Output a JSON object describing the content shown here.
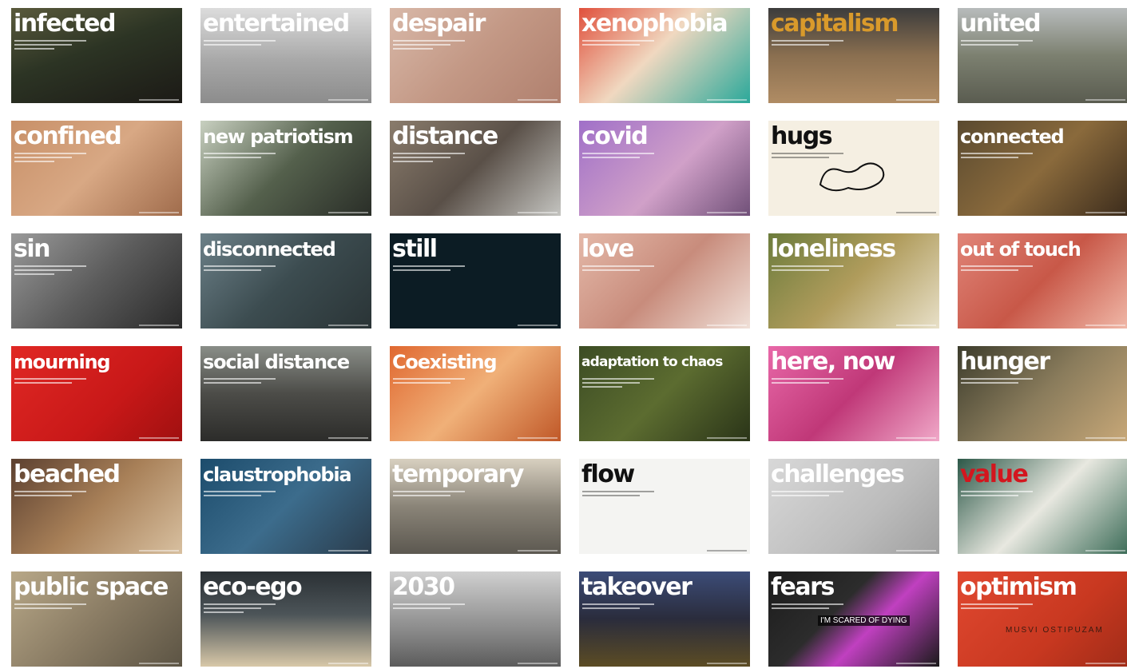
{
  "tiles": [
    {
      "word": "infected",
      "bg": "linear-gradient(160deg,#5a5a3c 0%,#2c3424 45%,#1c1a16 100%)"
    },
    {
      "word": "entertained",
      "bg": "linear-gradient(180deg,#dcdcdc 0%,#a8a8a8 55%,#8c8c8c 100%)"
    },
    {
      "word": "despair",
      "bg": "linear-gradient(135deg,#d8b8a8 0%,#c39885 50%,#b0806e 100%)"
    },
    {
      "word": "xenophobia",
      "bg": "linear-gradient(135deg,#e0503c 0%,#f0d8c0 45%,#2aa89a 100%)"
    },
    {
      "word": "capitalism",
      "bg": "linear-gradient(180deg,#3c3c3c 0%,#8a6f50 50%,#b08c64 100%)",
      "style": "gold"
    },
    {
      "word": "united",
      "bg": "linear-gradient(180deg,#b8bcbc 0%,#7c8070 50%,#5a5c50 100%)"
    },
    {
      "word": "confined",
      "bg": "linear-gradient(135deg,#c89068 0%,#d8a884 50%,#a06c4c 100%)"
    },
    {
      "word": "new patriotism",
      "bg": "linear-gradient(135deg,#c8d0c0 0%,#54604c 50%,#2a2e28 100%)",
      "style": "small"
    },
    {
      "word": "distance",
      "bg": "linear-gradient(135deg,#8a7c6c 0%,#5a5048 50%,#c4c4c0 100%)"
    },
    {
      "word": "covid",
      "bg": "linear-gradient(135deg,#a070c8 0%,#d0a0c8 55%,#705078 100%)"
    },
    {
      "word": "hugs",
      "bg": "#f5efe2",
      "style": "dark",
      "light": true
    },
    {
      "word": "connected",
      "bg": "linear-gradient(135deg,#5a4a30 0%,#8a6a3c 50%,#3c2c1c 100%)",
      "style": "small"
    },
    {
      "word": "sin",
      "bg": "linear-gradient(135deg,#9a9a9a 0%,#5c5c5c 50%,#2a2a2a 100%)"
    },
    {
      "word": "disconnected",
      "bg": "linear-gradient(135deg,#6c8088 0%,#3c4c50 50%,#2a3436 100%)",
      "style": "small"
    },
    {
      "word": "still",
      "bg": "#0c1c24"
    },
    {
      "word": "love",
      "bg": "linear-gradient(135deg,#e4b8a8 0%,#c88c7c 50%,#f0e0d8 100%)"
    },
    {
      "word": "loneliness",
      "bg": "linear-gradient(135deg,#6c7c3c 0%,#b09c5c 50%,#e8e0c8 100%)"
    },
    {
      "word": "out of touch",
      "bg": "linear-gradient(135deg,#e08478 0%,#c85848 50%,#f0b8a8 100%)",
      "style": "small"
    },
    {
      "word": "mourning",
      "bg": "linear-gradient(135deg,#e02824 0%,#c81818 60%,#a01010 100%)",
      "style": "small"
    },
    {
      "word": "social distance",
      "bg": "linear-gradient(180deg,#8a8e88 0%,#4c4c48 50%,#2c2c2a 100%)",
      "style": "small"
    },
    {
      "word": "Coexisting",
      "bg": "linear-gradient(135deg,#e06830 0%,#f0b078 50%,#c05828 100%)",
      "style": "small"
    },
    {
      "word": "adaptation to chaos",
      "bg": "linear-gradient(135deg,#3c4c24 0%,#5c6c30 50%,#2a3418 100%)",
      "style": "xsmall"
    },
    {
      "word": "here, now",
      "bg": "linear-gradient(135deg,#e868a8 0%,#c03878 50%,#f0a8c8 100%)"
    },
    {
      "word": "hunger",
      "bg": "linear-gradient(135deg,#3c3c2c 0%,#8a7c5c 50%,#c8a878 100%)"
    },
    {
      "word": "beached",
      "bg": "linear-gradient(135deg,#5c4030 0%,#a88058 50%,#d8c0a0 100%)"
    },
    {
      "word": "claustrophobia",
      "bg": "linear-gradient(135deg,#1c4c6c 0%,#3c6c8c 50%,#2a3c4c 100%)",
      "style": "small"
    },
    {
      "word": "temporary",
      "bg": "linear-gradient(180deg,#d8d0c0 0%,#8a8478 50%,#5c5850 100%)"
    },
    {
      "word": "flow",
      "bg": "#f4f4f2",
      "style": "dark",
      "light": true
    },
    {
      "word": "challenges",
      "bg": "linear-gradient(135deg,#d8d8d8 0%,#bcbcbc 60%,#a0a0a0 100%)"
    },
    {
      "word": "value",
      "bg": "linear-gradient(135deg,#2c5848 0%,#e8e8e0 50%,#3c6c58 100%)",
      "style": "red"
    },
    {
      "word": "public space",
      "bg": "linear-gradient(135deg,#b8a888 0%,#8a7c64 50%,#5c5444 100%)"
    },
    {
      "word": "eco-ego",
      "bg": "linear-gradient(180deg,#2a3034 0%,#4c5458 45%,#d8c8a8 100%)"
    },
    {
      "word": "2030",
      "bg": "linear-gradient(180deg,#d0d0d0 0%,#8c8c8c 60%,#5c5c5c 100%)"
    },
    {
      "word": "takeover",
      "bg": "linear-gradient(180deg,#3c4c78 0%,#2a2c3c 50%,#5c4c24 100%)"
    },
    {
      "word": "fears",
      "bg": "linear-gradient(135deg,#1c1c1c 0%,#2c2c2c 40%,#c040c0 60%,#1a1a1a 100%)",
      "overlay": "I'M SCARED OF DYING"
    },
    {
      "word": "optimism",
      "bg": "linear-gradient(135deg,#e04830 0%,#c83820 60%,#a02c18 100%)",
      "overlay": "MUSVI OSTIPUZAM"
    }
  ]
}
